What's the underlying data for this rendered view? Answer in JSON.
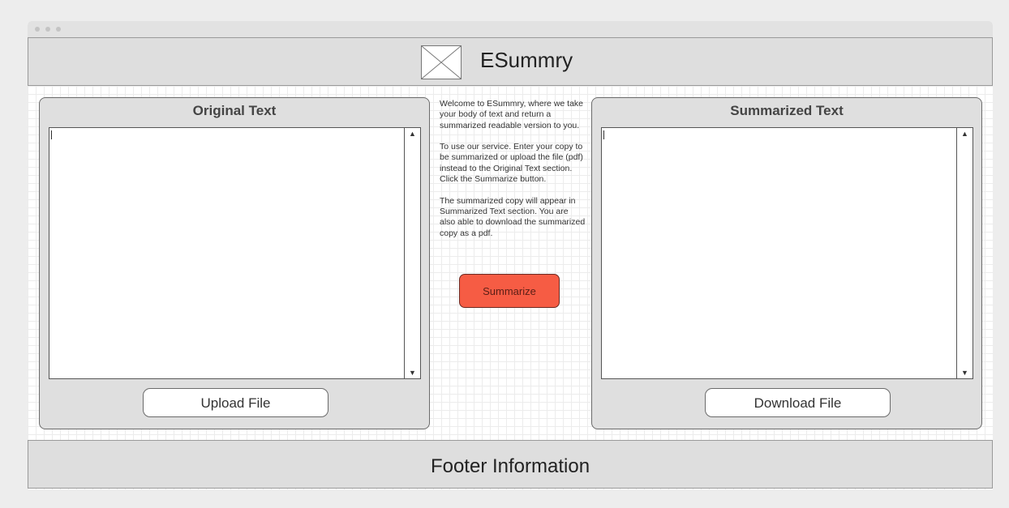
{
  "header": {
    "logo_icon": "image-placeholder-icon",
    "title": "ESummry"
  },
  "original_panel": {
    "title": "Original Text",
    "textarea_value": "",
    "button_label": "Upload File"
  },
  "info": {
    "paragraphs": [
      "Welcome to ESummry, where we take your body of text and return a summarized readable version to you.",
      "To use our service. Enter your copy to be summarized or upload the file (pdf) instead to the Original Text section. Click the Summarize button.",
      "The summarized copy will appear in Summarized Text section. You are also able to download the summarized copy as a pdf."
    ],
    "summarize_label": "Summarize"
  },
  "summarized_panel": {
    "title": "Summarized Text",
    "textarea_value": "",
    "button_label": "Download File"
  },
  "footer": {
    "text": "Footer Information"
  },
  "icons": {
    "scroll_up": "▲",
    "scroll_down": "▼"
  },
  "colors": {
    "accent": "#f65c44",
    "panel_bg": "#dfdfdf",
    "header_bg": "#dedede"
  }
}
